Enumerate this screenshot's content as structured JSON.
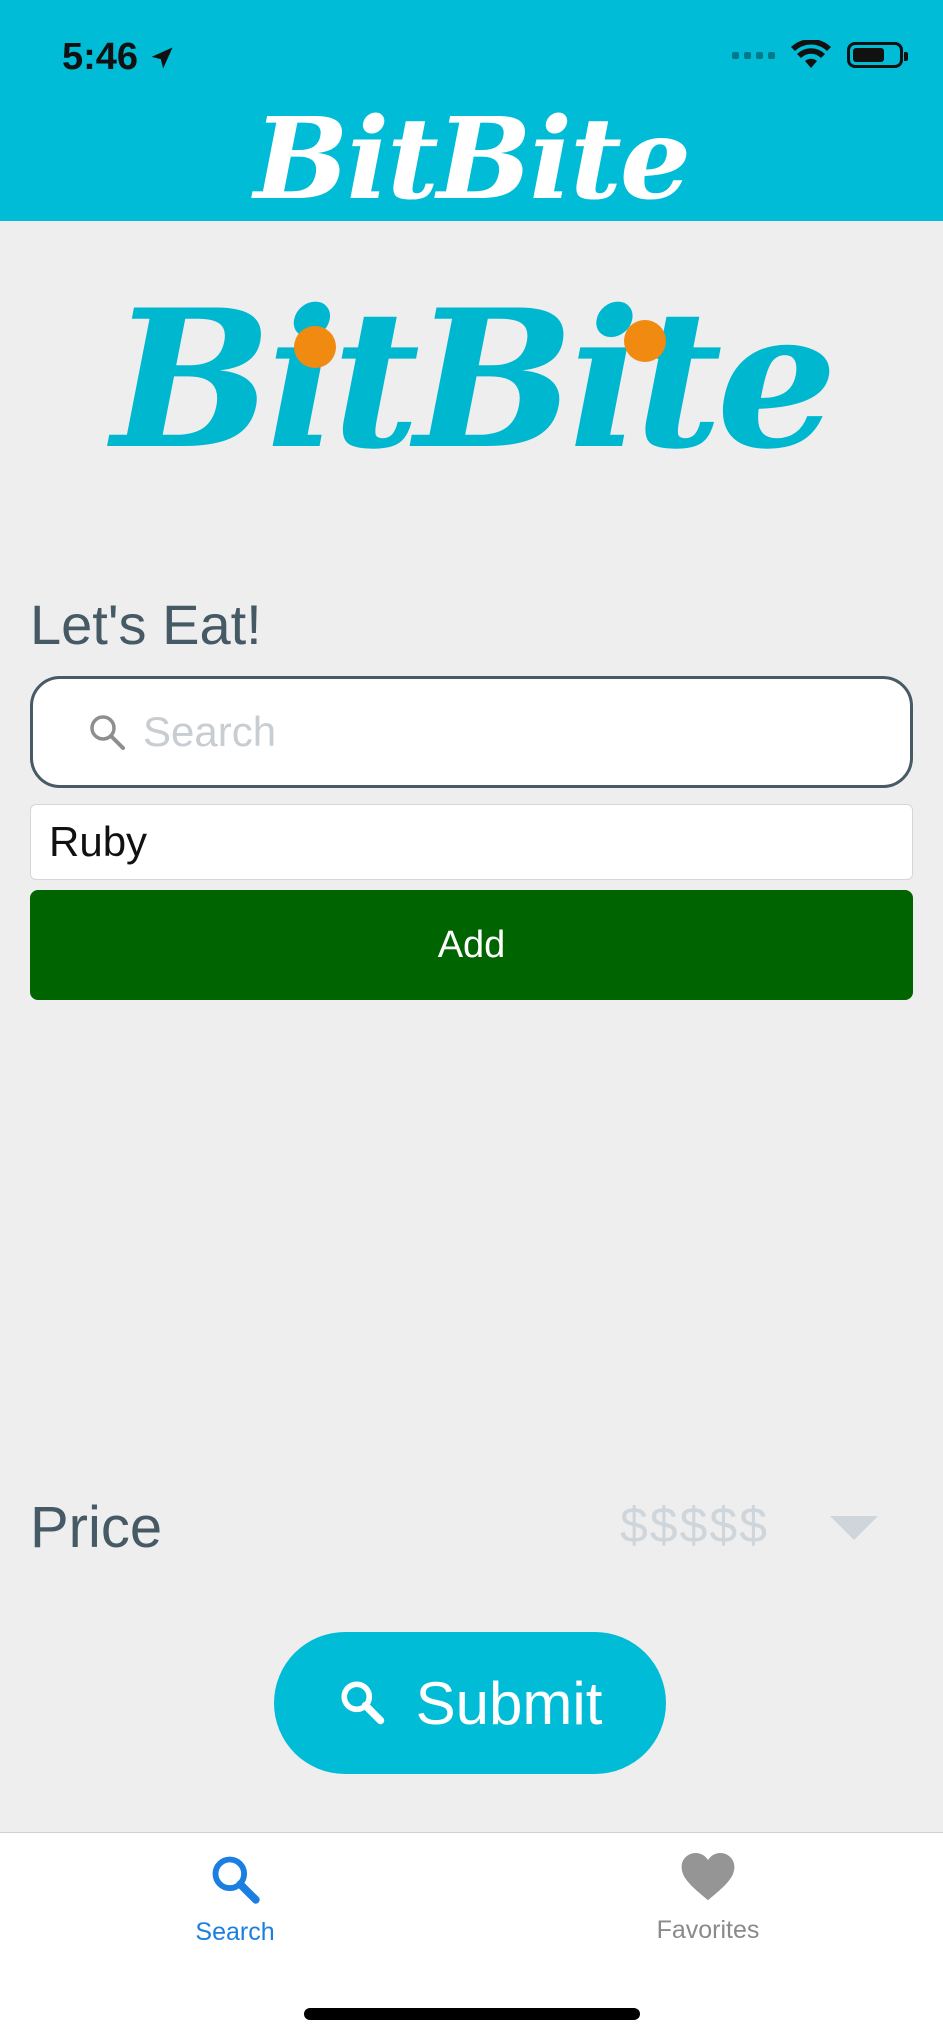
{
  "status_bar": {
    "time": "5:46"
  },
  "header": {
    "logo_text": "BitBite"
  },
  "main": {
    "logo_text": "BitBite",
    "heading": "Let's Eat!",
    "search": {
      "placeholder": "Search",
      "value": ""
    },
    "added_item": "Ruby",
    "add_label": "Add",
    "price": {
      "label": "Price",
      "selected": "$$$$$"
    },
    "submit_label": "Submit"
  },
  "tab_bar": {
    "tabs": [
      {
        "label": "Search",
        "icon": "search-icon",
        "active": true
      },
      {
        "label": "Favorites",
        "icon": "heart-icon",
        "active": false
      }
    ]
  },
  "colors": {
    "header_bg": "#00bcd6",
    "logo_primary": "#00b7d0",
    "logo_accent": "#f08a10",
    "add_button": "#006400",
    "submit_button": "#00bcd6",
    "tab_active": "#1a7fe0",
    "tab_inactive": "#8a8a8a"
  }
}
